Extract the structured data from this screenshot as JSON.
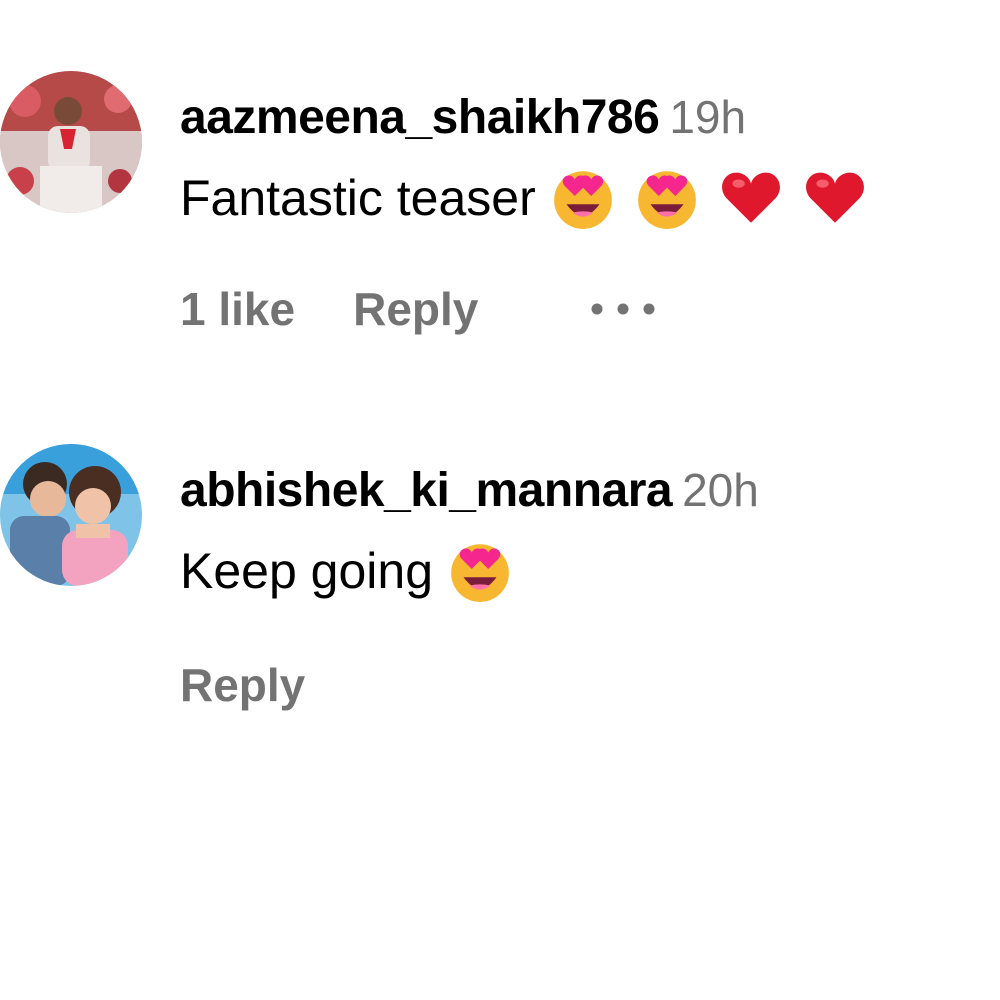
{
  "comments": [
    {
      "username": "aazmeena_shaikh786",
      "time": "19h",
      "text": "Fantastic teaser",
      "emojis": [
        "heart-eyes-icon",
        "heart-eyes-icon",
        "red-heart-icon",
        "red-heart-icon"
      ],
      "likes": "1 like",
      "reply_label": "Reply",
      "has_more": true
    },
    {
      "username": "abhishek_ki_mannara",
      "time": "20h",
      "text": "Keep going",
      "emojis": [
        "heart-eyes-icon"
      ],
      "reply_label": "Reply"
    }
  ],
  "colors": {
    "username": "#000000",
    "secondary": "#737373",
    "emoji_face": "#f7b731",
    "heart": "#e0182d",
    "heart_eyes": "#f5268e"
  }
}
